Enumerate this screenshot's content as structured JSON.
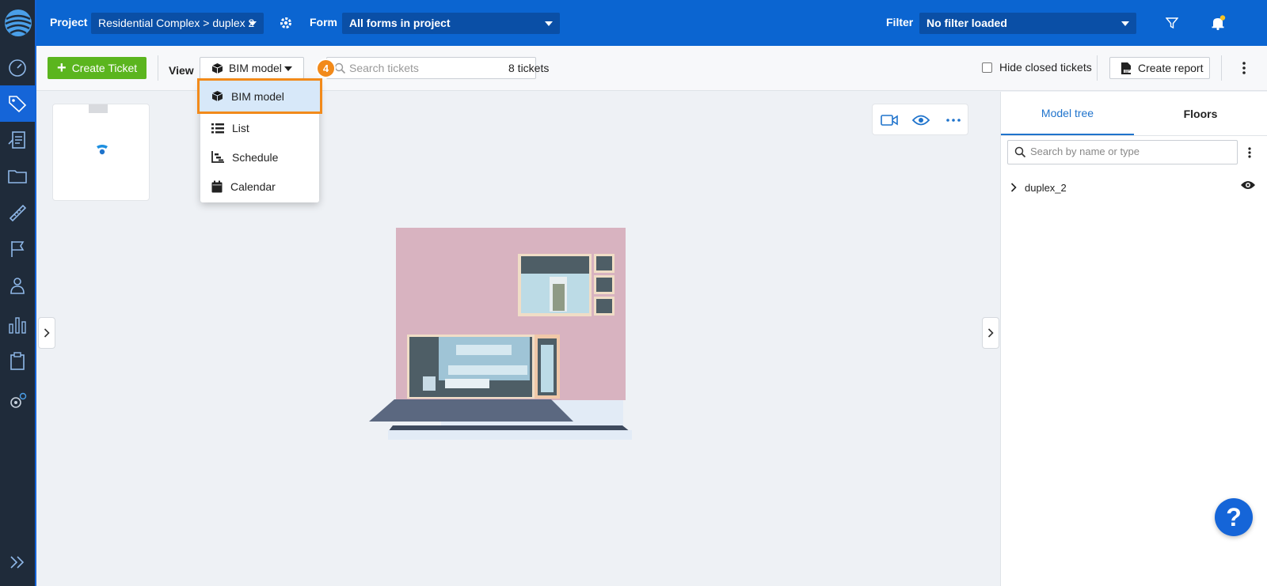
{
  "topbar": {
    "project_label": "Project",
    "project_value": "Residential Complex > duplex 2",
    "form_label": "Form",
    "form_value": "All forms in project",
    "filter_label": "Filter",
    "filter_value": "No filter loaded"
  },
  "toolbar": {
    "create_ticket": "Create Ticket",
    "view_label": "View",
    "view_value": "BIM model",
    "search_placeholder": "Search tickets",
    "step_badge": "4",
    "ticket_count": "8 tickets",
    "hide_closed": "Hide closed tickets",
    "create_report": "Create report"
  },
  "view_menu": {
    "items": [
      {
        "label": "BIM model",
        "icon": "cube-icon",
        "selected": true
      },
      {
        "label": "List",
        "icon": "list-icon"
      },
      {
        "label": "Schedule",
        "icon": "schedule-icon"
      },
      {
        "label": "Calendar",
        "icon": "calendar-icon"
      }
    ]
  },
  "right_panel": {
    "tabs": [
      "Model tree",
      "Floors"
    ],
    "active_tab": "Model tree",
    "search_placeholder": "Search by name or type",
    "tree_items": [
      "duplex_2"
    ]
  },
  "help": {
    "label": "?"
  },
  "colors": {
    "topbar": "#0b65d1",
    "rail": "#1f2b3a",
    "accent_green": "#5bb51e",
    "highlight_orange": "#f28a1a",
    "active_tab": "#1f73cc"
  }
}
